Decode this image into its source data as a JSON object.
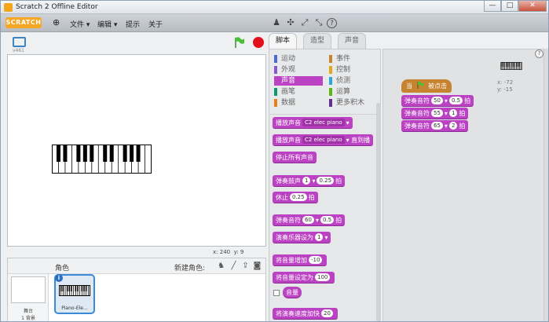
{
  "window": {
    "title": "Scratch 2 Offline Editor",
    "minimize": "—",
    "maximize": "□",
    "close": "✕"
  },
  "menubar": {
    "logo": "SCRATCH",
    "items": [
      {
        "label": "文件 ▾"
      },
      {
        "label": "编辑 ▾"
      },
      {
        "label": "提示"
      },
      {
        "label": "关于"
      }
    ],
    "tools": [
      {
        "icon": "stamp-icon",
        "glyph": "♟"
      },
      {
        "icon": "move-icon",
        "glyph": "✣"
      },
      {
        "icon": "grow-icon",
        "glyph": "⤢"
      },
      {
        "icon": "shrink-icon",
        "glyph": "⤡"
      },
      {
        "icon": "help-icon",
        "glyph": "?"
      }
    ]
  },
  "stage": {
    "version": "v461",
    "x_label": "x:",
    "x_value": "240",
    "y_label": "y:",
    "y_value": "9"
  },
  "sprites_panel": {
    "header": "角色",
    "new_sprite_label": "新建角色:",
    "stage_title": "舞台",
    "stage_backdrops": "1 背景",
    "sprites": [
      {
        "name": "Piano-Ele..."
      }
    ]
  },
  "tabs": [
    {
      "label": "脚本",
      "active": true
    },
    {
      "label": "造型",
      "active": false
    },
    {
      "label": "声音",
      "active": false
    }
  ],
  "categories": [
    {
      "label": "运动",
      "color": "#4a6cd4",
      "active": false
    },
    {
      "label": "事件",
      "color": "#c88330",
      "active": false
    },
    {
      "label": "外观",
      "color": "#8a55d7",
      "active": false
    },
    {
      "label": "控制",
      "color": "#e1a91a",
      "active": false
    },
    {
      "label": "声音",
      "color": "#bb42c3",
      "active": true
    },
    {
      "label": "侦测",
      "color": "#2ca5e2",
      "active": false
    },
    {
      "label": "画笔",
      "color": "#0e9a6c",
      "active": false
    },
    {
      "label": "运算",
      "color": "#5cb712",
      "active": false
    },
    {
      "label": "数据",
      "color": "#ee7d16",
      "active": false
    },
    {
      "label": "更多积木",
      "color": "#632d99",
      "active": false
    }
  ],
  "palette_blocks": {
    "play_sound": {
      "label": "播放声音",
      "value": "C2 elec piano"
    },
    "play_sound_wait": {
      "label": "播放声音",
      "value": "C2 elec piano",
      "suffix": "直到播"
    },
    "stop_all": {
      "label": "停止所有声音"
    },
    "play_drum": {
      "label": "弹奏鼓声",
      "v1": "1",
      "v2": "0.25",
      "suffix": "拍"
    },
    "rest": {
      "label": "休止",
      "v1": "0.25",
      "suffix": "拍"
    },
    "play_note": {
      "label": "弹奏音符",
      "v1": "60",
      "v2": "0.5",
      "suffix": "拍"
    },
    "set_instrument": {
      "label": "演奏乐器设为",
      "v1": "1"
    },
    "change_volume": {
      "label": "将音量增加",
      "v1": "-10"
    },
    "set_volume": {
      "label": "将音量设定为",
      "v1": "100"
    },
    "volume": {
      "label": "音量"
    },
    "change_tempo": {
      "label": "将演奏速度加快",
      "v1": "20"
    }
  },
  "script": {
    "hat": {
      "prefix": "当",
      "suffix": "被点击"
    },
    "notes": [
      {
        "label": "弹奏音符",
        "note": "50",
        "beats": "0.5",
        "suffix": "拍"
      },
      {
        "label": "弹奏音符",
        "note": "55",
        "beats": "1",
        "suffix": "拍"
      },
      {
        "label": "弹奏音符",
        "note": "65",
        "beats": "2",
        "suffix": "拍"
      }
    ],
    "x_label": "x:",
    "x_value": "-72",
    "y_label": "y:",
    "y_value": "-15"
  },
  "colors": {
    "sound": "#bb42c3",
    "events": "#c88330",
    "flag": "#4cbf3a",
    "stop": "#e30f1b"
  }
}
